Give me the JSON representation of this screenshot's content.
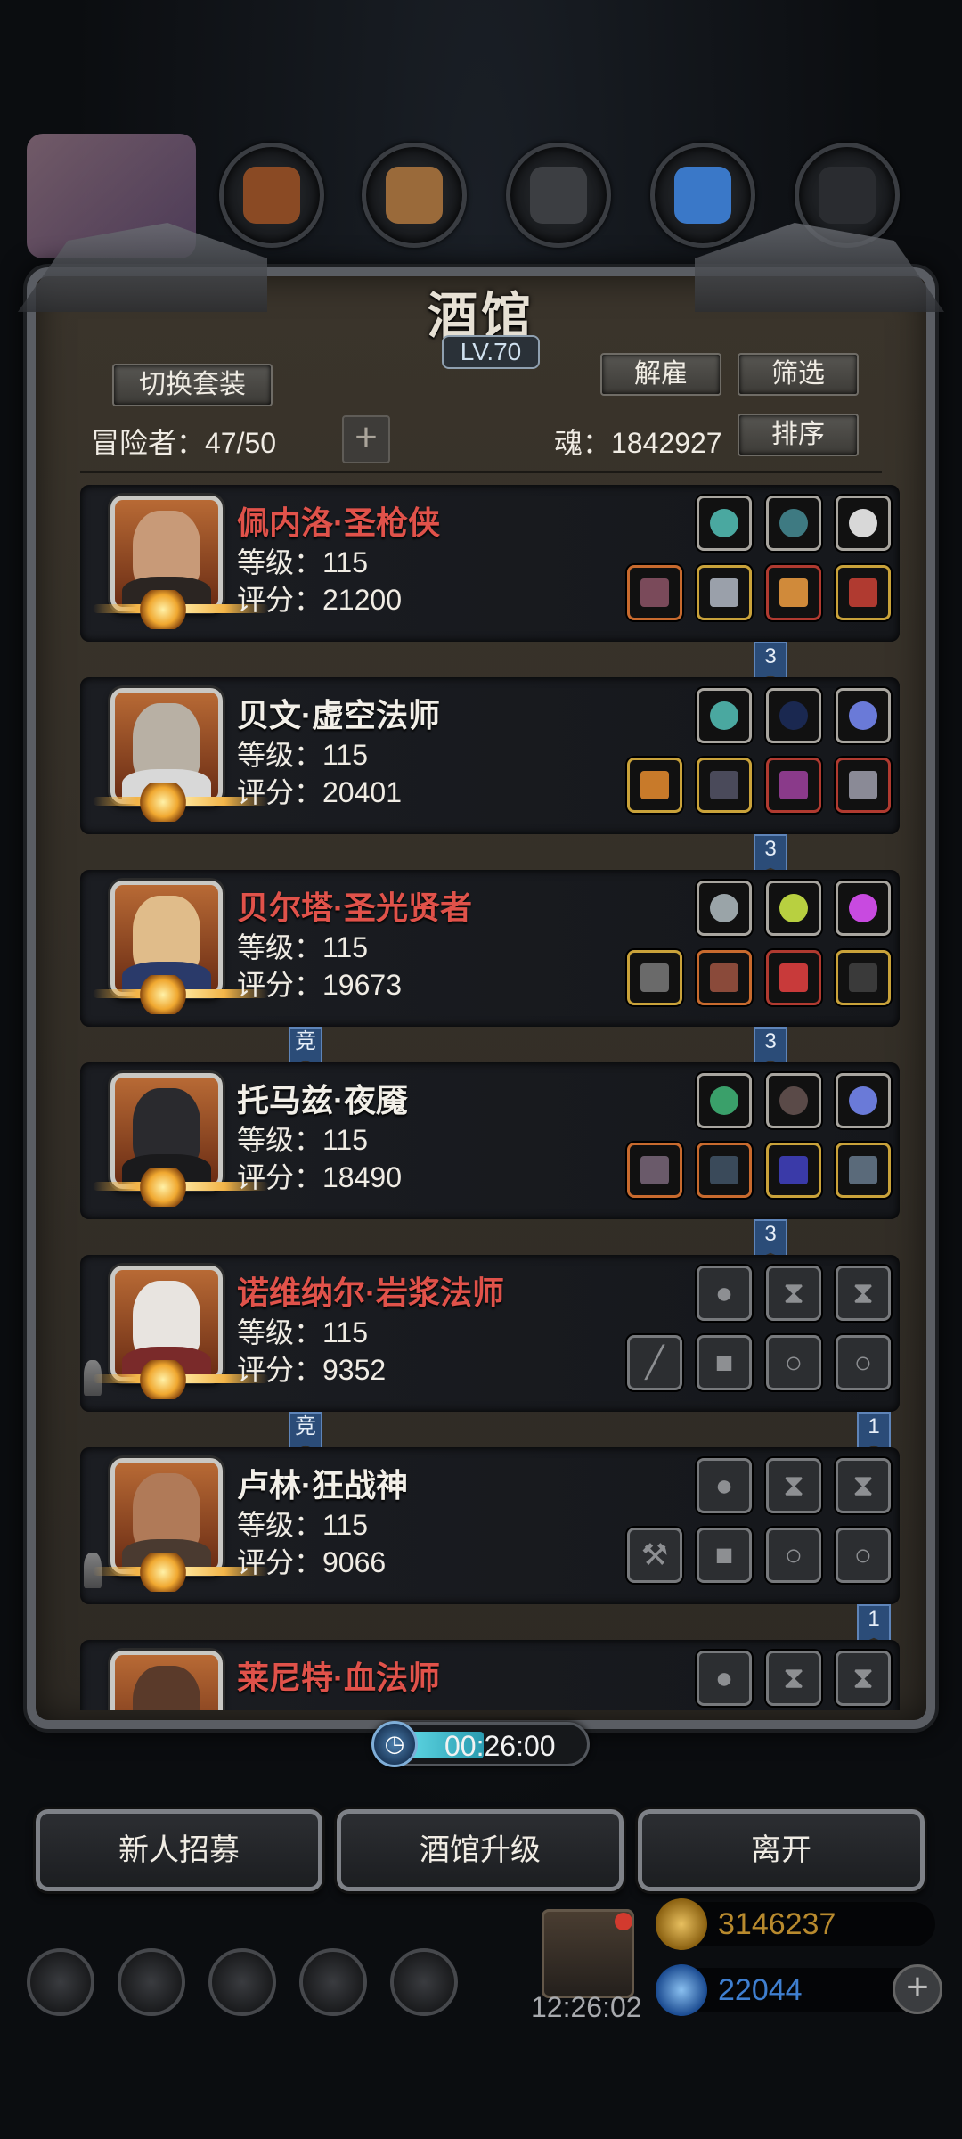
{
  "tavern": {
    "title": "酒馆",
    "level": "LV.70",
    "buttons": {
      "switch_outfit": "切换套装",
      "dismiss": "解雇",
      "filter": "筛选",
      "sort": "排序",
      "add": "+"
    },
    "adventurers_label": "冒险者：47/50",
    "soul_label": "魂：1842927"
  },
  "heroes": [
    {
      "name": "佩内洛·圣枪侠",
      "name_color": "red",
      "level": "等级：115",
      "score": "评分：21200",
      "tag_right": "3",
      "tag_left": ""
    },
    {
      "name": "贝文·虚空法师",
      "name_color": "white",
      "level": "等级：115",
      "score": "评分：20401",
      "tag_right": "3",
      "tag_left": ""
    },
    {
      "name": "贝尔塔·圣光贤者",
      "name_color": "red",
      "level": "等级：115",
      "score": "评分：19673",
      "tag_right": "3",
      "tag_left": "竞"
    },
    {
      "name": "托马兹·夜魇",
      "name_color": "white",
      "level": "等级：115",
      "score": "评分：18490",
      "tag_right": "3",
      "tag_left": ""
    },
    {
      "name": "诺维纳尔·岩浆法师",
      "name_color": "red",
      "level": "等级：115",
      "score": "评分：9352",
      "tag_right": "1",
      "tag_left": "竞"
    },
    {
      "name": "卢林·狂战神",
      "name_color": "white",
      "level": "等级：115",
      "score": "评分：9066",
      "tag_right": "1",
      "tag_left": ""
    },
    {
      "name": "莱尼特·血法师",
      "name_color": "red",
      "level": "",
      "score": "",
      "tag_right": "",
      "tag_left": ""
    }
  ],
  "timer": {
    "value": "00:26:00"
  },
  "actions": {
    "recruit": "新人招募",
    "upgrade": "酒馆升级",
    "leave": "离开"
  },
  "hud": {
    "clock": "12:26:02",
    "gold": "3146237",
    "gems": "22044",
    "plus": "+"
  },
  "colors": {
    "red_name": "#e0524a",
    "gold_text": "#b88a2e",
    "gem_text": "#3f7fd0"
  }
}
